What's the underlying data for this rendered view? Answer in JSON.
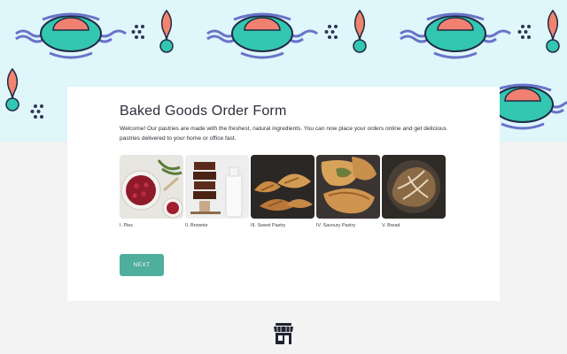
{
  "form": {
    "title": "Baked Goods Order Form",
    "intro": "Welcome! Our pastries are made with the freshest, natural ingredients. You can now place your orders online and get delicious pastries delivered to your home or office fast.",
    "next_label": "NEXT"
  },
  "products": [
    {
      "label": "I. Pies",
      "image": "pies-photo"
    },
    {
      "label": "II. Brownie",
      "image": "brownie-photo"
    },
    {
      "label": "III. Sweet Pastry",
      "image": "sweet-pastry-photo"
    },
    {
      "label": "IV. Savoury Pastry",
      "image": "savoury-pastry-photo"
    },
    {
      "label": "V. Bread",
      "image": "bread-photo"
    }
  ],
  "footer": {
    "icon": "store-icon"
  },
  "colors": {
    "accent": "#4fae9d",
    "banner_bg": "#dff6fb",
    "page_bg": "#f3f3f3",
    "card_bg": "#ffffff"
  }
}
